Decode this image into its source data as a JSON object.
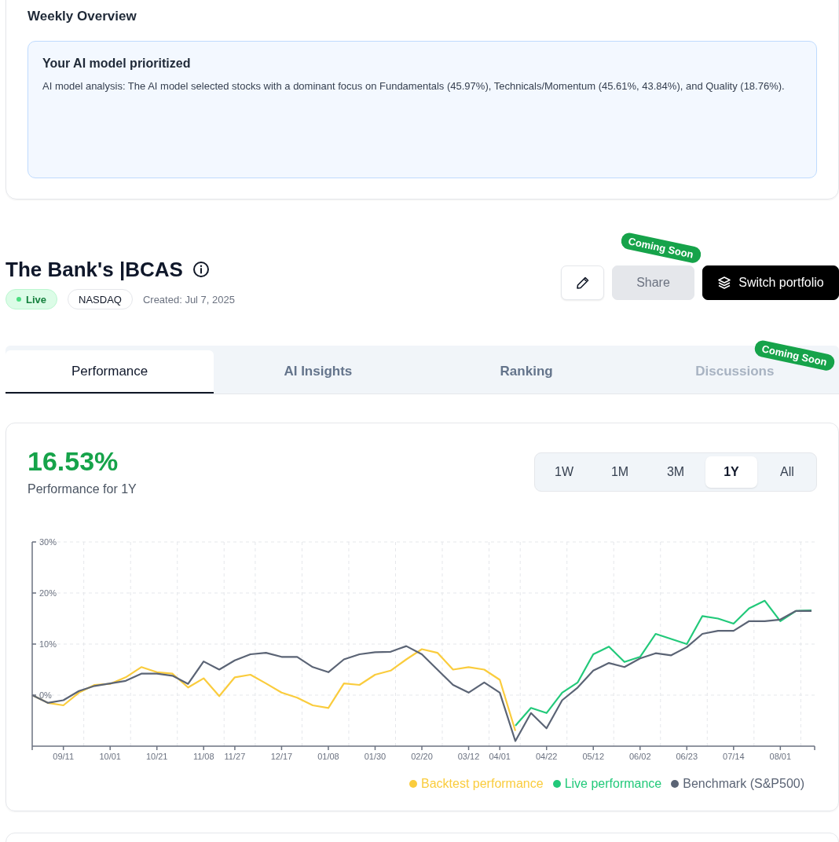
{
  "weekly_overview": {
    "title": "Weekly Overview",
    "insight": {
      "title": "Your AI model prioritized",
      "text": "AI model analysis: The AI model selected stocks with a dominant focus on Fundamentals (45.97%), Technicals/Momentum (45.61%, 43.84%), and Quality (18.76%)."
    }
  },
  "portfolio": {
    "name": "The Bank's |BCAS",
    "tags": [
      {
        "label": "Live",
        "kind": "status"
      },
      {
        "label": "NASDAQ",
        "kind": "exchange"
      }
    ],
    "created": "Created: Jul 7, 2025"
  },
  "actions": [
    {
      "kind": "edit"
    },
    {
      "kind": "share",
      "label": "Share",
      "disabled": true,
      "badge": "Coming Soon"
    },
    {
      "kind": "switch",
      "label": "Switch portfolio"
    }
  ],
  "tabs": [
    {
      "label": "Performance",
      "selected": true,
      "disabled": false
    },
    {
      "label": "AI Insights",
      "selected": false,
      "disabled": false
    },
    {
      "label": "Ranking",
      "selected": false,
      "disabled": false
    },
    {
      "label": "Discussions",
      "selected": false,
      "disabled": true,
      "badge": "Coming Soon"
    }
  ],
  "performance": {
    "value": "16.53%",
    "caption": "Performance for 1Y",
    "ranges": [
      {
        "label": "1W",
        "selected": false
      },
      {
        "label": "1M",
        "selected": false
      },
      {
        "label": "3M",
        "selected": false
      },
      {
        "label": "1Y",
        "selected": true
      },
      {
        "label": "All",
        "selected": false
      }
    ],
    "chart_data": {
      "type": "line",
      "grid": true,
      "legend": "bottom-right",
      "categories": [
        null,
        null,
        "09/11",
        null,
        null,
        "10/01",
        null,
        null,
        "10/21",
        null,
        null,
        "11/08",
        null,
        "11/27",
        null,
        null,
        "12/17",
        null,
        null,
        "01/08",
        null,
        null,
        "01/30",
        null,
        null,
        "02/20",
        null,
        null,
        "03/12",
        null,
        "04/01",
        null,
        null,
        "04/22",
        null,
        null,
        "05/12",
        null,
        null,
        "06/02",
        null,
        null,
        "06/23",
        null,
        null,
        "07/14",
        null,
        null,
        "08/01",
        null,
        null
      ],
      "ylim": [
        -10,
        30
      ],
      "yticks": [
        {
          "value": 0,
          "label": "0%"
        },
        {
          "value": 10,
          "label": "10%"
        },
        {
          "value": 20,
          "label": "20%"
        },
        {
          "value": 30,
          "label": "30%"
        }
      ],
      "series": [
        {
          "name": "Backtest performance",
          "color": "#facc3d",
          "values": [
            0,
            -1.5,
            -2,
            0.5,
            2,
            2.2,
            3.5,
            5.5,
            4.5,
            4.2,
            1.5,
            3.3,
            -0.2,
            3.5,
            4,
            2.3,
            0.5,
            -0.5,
            -2,
            -2.5,
            2.3,
            2,
            4,
            4.8,
            7,
            9,
            8.3,
            5,
            5.5,
            5,
            3,
            -7,
            null,
            null,
            null,
            null,
            null,
            null,
            null,
            null,
            null,
            null,
            null,
            null,
            null,
            null,
            null,
            null,
            null,
            null,
            null
          ]
        },
        {
          "name": "Live performance",
          "color": "#22c97a",
          "values": [
            null,
            null,
            null,
            null,
            null,
            null,
            null,
            null,
            null,
            null,
            null,
            null,
            null,
            null,
            null,
            null,
            null,
            null,
            null,
            null,
            null,
            null,
            null,
            null,
            null,
            null,
            null,
            null,
            null,
            null,
            null,
            -6,
            -2.5,
            -3.5,
            0.5,
            2.5,
            8,
            9.5,
            6.5,
            7.5,
            12,
            11,
            10,
            15.5,
            15,
            14,
            17,
            18.5,
            14.5,
            16.5,
            16.6
          ]
        },
        {
          "name": "Benchmark (S&P500)",
          "color": "#5b6475",
          "values": [
            0,
            -1.5,
            -1,
            0.8,
            1.8,
            2.3,
            2.8,
            4.2,
            4.2,
            3.8,
            2.2,
            6.6,
            5,
            6.8,
            8,
            8.3,
            7.5,
            7.5,
            5.5,
            4.5,
            7,
            8,
            8.4,
            8.5,
            9.6,
            8,
            5,
            2,
            0.5,
            2.5,
            0.5,
            -9,
            -3.5,
            -6.5,
            -1,
            1.5,
            4.8,
            6.3,
            5.5,
            7.2,
            8.2,
            7.8,
            9.4,
            12,
            12.6,
            12.6,
            14.5,
            14.5,
            14.8,
            16.5,
            16.5
          ]
        }
      ]
    }
  }
}
